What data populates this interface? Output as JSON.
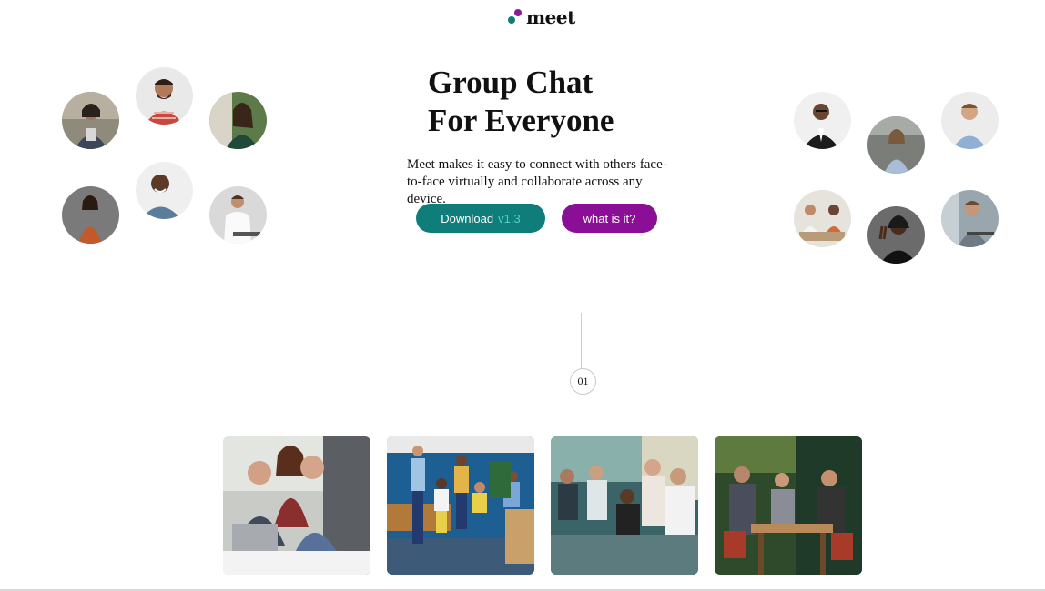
{
  "brand": {
    "name": "meet"
  },
  "hero": {
    "title_line1": "Group Chat",
    "title_line2": "For Everyone",
    "description": "Meet makes it easy to connect with others face-to-face virtually and collaborate across any device."
  },
  "buttons": {
    "download_label": "Download",
    "download_version": "v1.3",
    "what_label": "what is it?"
  },
  "timeline": {
    "step": "01"
  },
  "colors": {
    "teal": "#0f7e7b",
    "purple": "#8a0f96",
    "accent_teal": "#4fd1c5"
  }
}
